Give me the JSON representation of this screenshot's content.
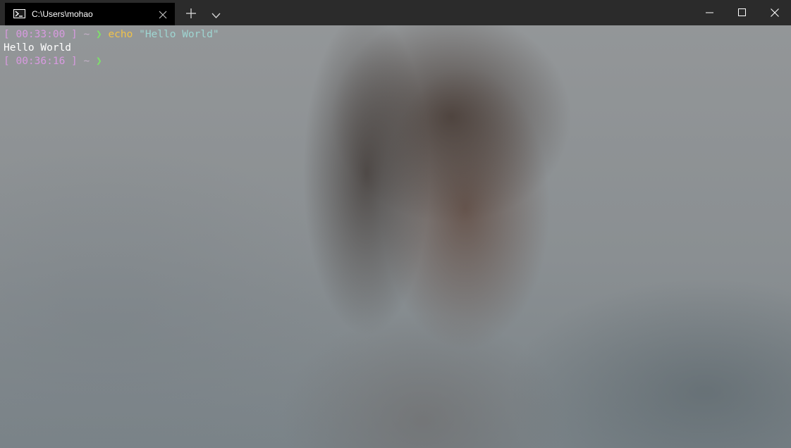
{
  "window": {
    "tab": {
      "title": "C:\\Users\\mohao",
      "icon": "powershell-icon"
    },
    "controls": [
      "minimize-icon",
      "maximize-icon",
      "close-icon"
    ]
  },
  "terminal": {
    "lines": [
      {
        "time": "[ 00:33:00 ]",
        "path": "~",
        "arrow": "❯",
        "command": "echo",
        "argument": "\"Hello World\""
      },
      {
        "output": "Hello World"
      },
      {
        "time": "[ 00:36:16 ]",
        "path": "~",
        "arrow": "❯"
      }
    ]
  },
  "colors": {
    "titlebar": "#2b2b2b",
    "tab": "#000000",
    "prompt_time": "#d89ae0",
    "prompt_arrow": "#7ee06a",
    "command": "#f1c349",
    "string": "#9ed6d2",
    "output": "#ffffff"
  }
}
